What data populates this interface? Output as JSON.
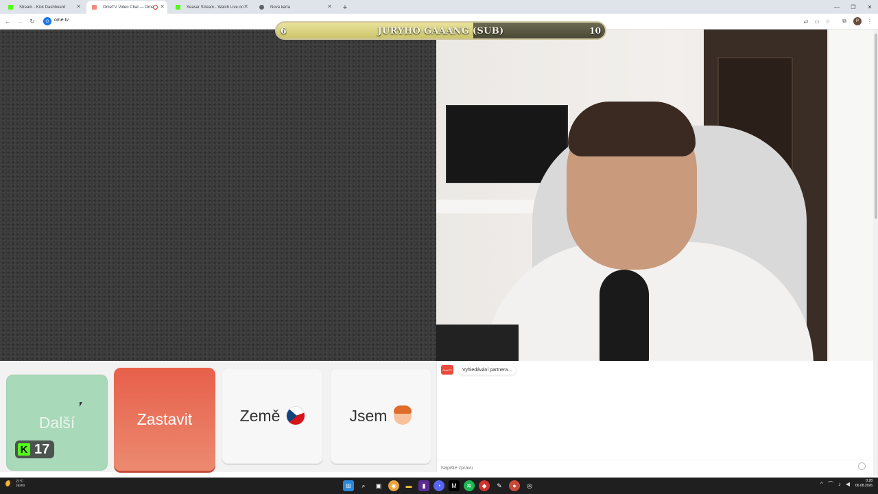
{
  "browser": {
    "tabs": [
      {
        "title": "Stream - Kick Dashboard",
        "favicon_color": "#53fc18",
        "active": false
      },
      {
        "title": "OmeTV Video Chat — Ome",
        "favicon_color": "#f28b82",
        "active": true
      },
      {
        "title": "Seasar Stream - Watch Live on",
        "favicon_color": "#53fc18",
        "active": false
      },
      {
        "title": "Nová karta",
        "favicon_color": "#5f6368",
        "active": false
      }
    ],
    "url": "ome.tv",
    "profile_initial": "P"
  },
  "overlay": {
    "sub_goal_title": "JURYHO GAAANG (SUB)",
    "sub_current": "6",
    "sub_target": "10",
    "sub_progress": 0.6
  },
  "controls": {
    "next_label": "Další",
    "stop_label": "Zastavit",
    "country_label": "Země",
    "gender_label": "Jsem",
    "kick_count": "17"
  },
  "chat": {
    "logo_text": "OmeTV",
    "status_message": "Vyhledávání partnera...",
    "input_placeholder": "Napište zprávu"
  },
  "taskbar": {
    "temperature": "21°C",
    "weather": "Jasno",
    "time": "0:28",
    "date": "06.08.2026"
  },
  "colors": {
    "stop_button": "#e7604a",
    "next_button": "#a8d9b8",
    "kick_green": "#53fc18"
  }
}
